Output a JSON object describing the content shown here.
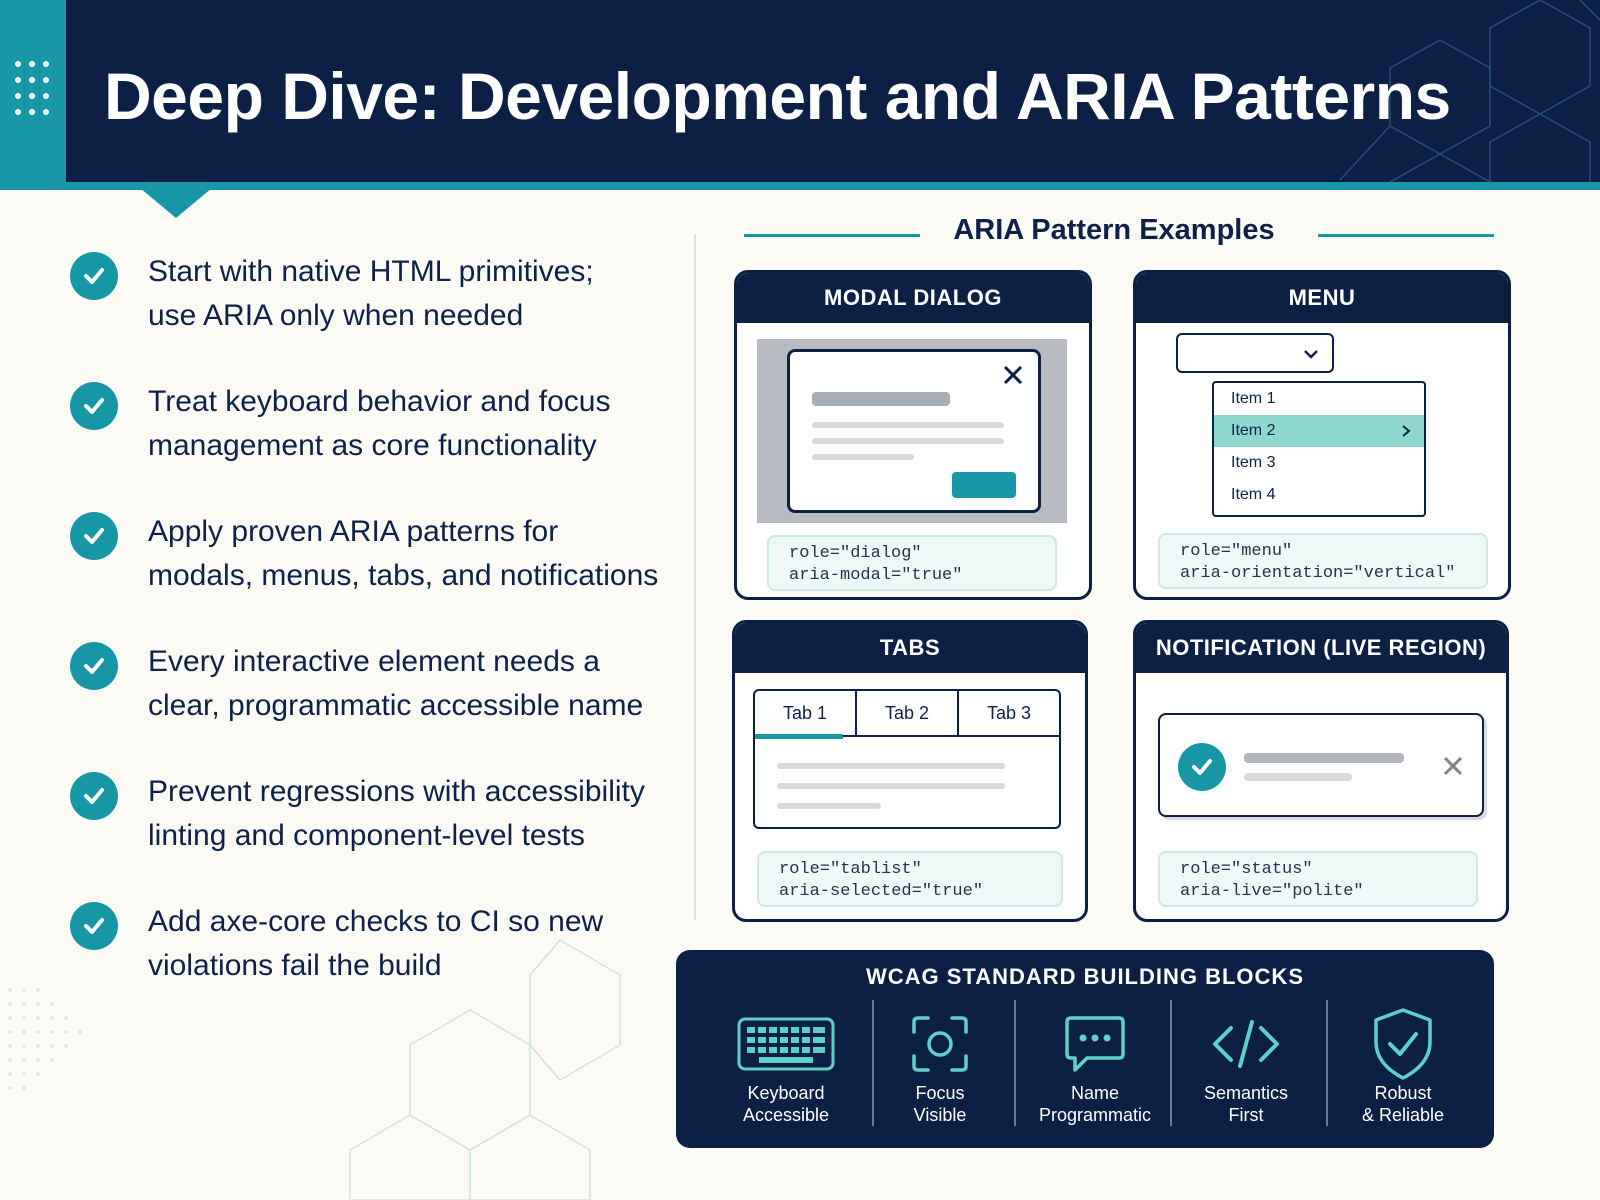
{
  "header": {
    "title": "Deep Dive: Development and ARIA Patterns"
  },
  "bullets": [
    {
      "line1": "Start with native HTML primitives;",
      "line2": "use ARIA only when needed"
    },
    {
      "line1": "Treat keyboard behavior and focus",
      "line2": "management as core functionality"
    },
    {
      "line1": "Apply proven ARIA patterns for",
      "line2": "modals, menus, tabs, and notifications"
    },
    {
      "line1": "Every interactive element needs a",
      "line2": "clear, programmatic accessible name"
    },
    {
      "line1": "Prevent regressions with accessibility",
      "line2": "linting and component-level tests"
    },
    {
      "line1": "Add axe-core checks to CI so new",
      "line2": "violations fail the build"
    }
  ],
  "aria_section": {
    "title": "ARIA Pattern Examples",
    "modal": {
      "title": "MODAL DIALOG",
      "code": "role=\"dialog\"\naria-modal=\"true\""
    },
    "menu": {
      "title": "MENU",
      "items": [
        "Item 1",
        "Item 2",
        "Item 3",
        "Item 4"
      ],
      "active_index": 1,
      "code": "role=\"menu\"\naria-orientation=\"vertical\""
    },
    "tabs": {
      "title": "TABS",
      "tabs": [
        "Tab 1",
        "Tab 2",
        "Tab 3"
      ],
      "code": "role=\"tablist\"\naria-selected=\"true\""
    },
    "notification": {
      "title": "NOTIFICATION (LIVE REGION)",
      "code": "role=\"status\"\naria-live=\"polite\""
    }
  },
  "wcag": {
    "title": "WCAG STANDARD BUILDING BLOCKS",
    "items": [
      {
        "icon": "keyboard-icon",
        "line1": "Keyboard",
        "line2": "Accessible"
      },
      {
        "icon": "focus-icon",
        "line1": "Focus",
        "line2": "Visible"
      },
      {
        "icon": "chat-bubble-icon",
        "line1": "Name",
        "line2": "Programmatic"
      },
      {
        "icon": "code-icon",
        "line1": "Semantics",
        "line2": "First"
      },
      {
        "icon": "shield-check-icon",
        "line1": "Robust",
        "line2": "& Reliable"
      }
    ]
  },
  "colors": {
    "navy": "#0c1f45",
    "teal": "#1797a6",
    "mint": "#8fd8cf",
    "background": "#fbfaf4"
  }
}
